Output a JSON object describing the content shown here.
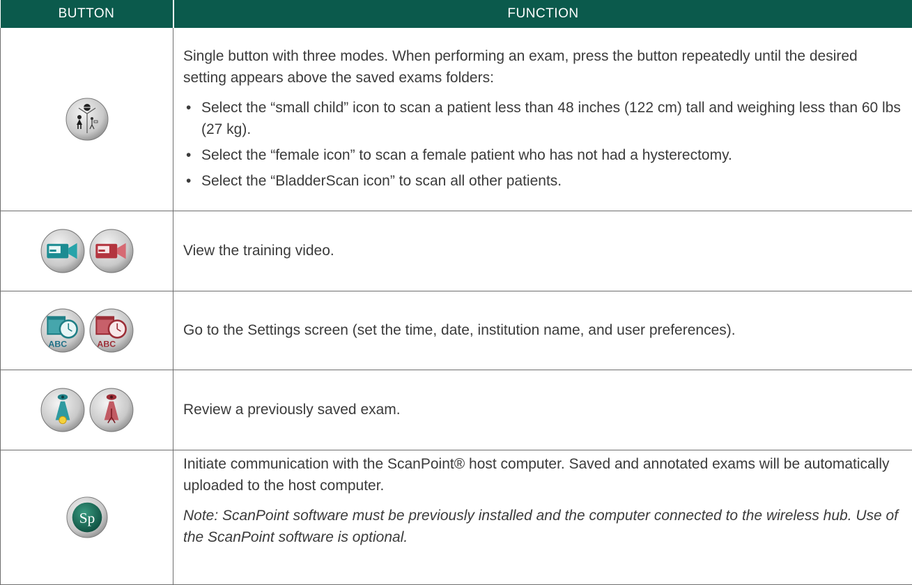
{
  "table": {
    "headers": [
      "BUTTON",
      "FUNCTION"
    ],
    "header_color": "#0b5a4c",
    "rows": [
      {
        "icons": [
          "mode-child-female-bladder-icon"
        ],
        "intro": "Single button with three modes. When performing an exam, press the button repeatedly until the desired setting appears above the saved exams folders:",
        "bullets": [
          "Select the “small child” icon to scan a patient less than 48 inches (122 cm) tall and weighing less than 60 lbs (27 kg).",
          "Select the “female icon” to scan a female patient who has not had a hysterectomy.",
          "Select the “BladderScan icon” to scan all other patients."
        ]
      },
      {
        "icons": [
          "video-camera-teal-icon",
          "video-camera-red-icon"
        ],
        "text": "View the training video."
      },
      {
        "icons": [
          "settings-calendar-clock-teal-icon",
          "settings-calendar-clock-red-icon"
        ],
        "icon_label": "ABC",
        "text": "Go to the Settings screen (set the time, date, institution name, and user preferences)."
      },
      {
        "icons": [
          "review-exam-teal-icon",
          "review-exam-red-icon"
        ],
        "text": "Review a previously saved exam."
      },
      {
        "icons": [
          "scanpoint-sp-icon"
        ],
        "icon_label": "Sp",
        "text": "Initiate communication with the ScanPoint® host computer. Saved and annotated exams will be automatically uploaded to the host computer.",
        "note": "Note: ScanPoint software must be previously installed and the computer connected to the wireless hub. Use of the ScanPoint software is optional."
      }
    ]
  }
}
